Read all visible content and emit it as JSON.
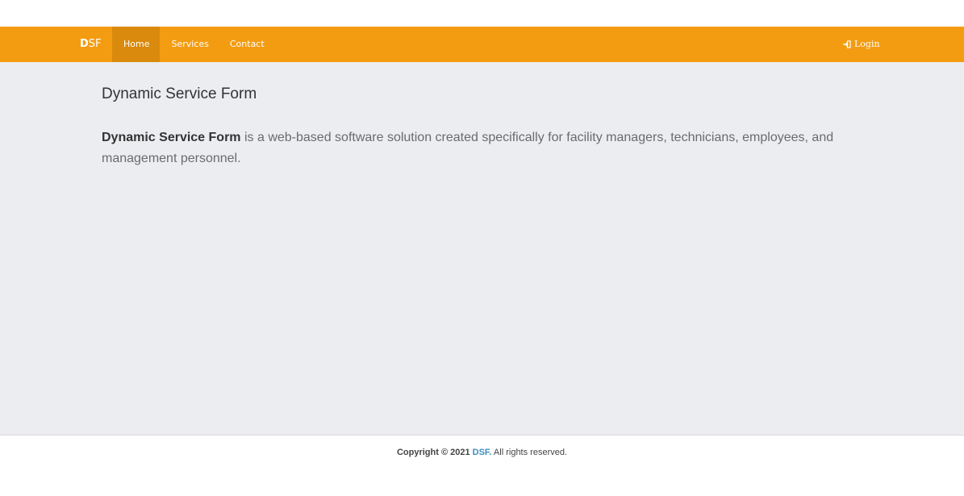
{
  "navbar": {
    "brand_bold": "D",
    "brand_rest": "SF",
    "items": [
      {
        "label": "Home",
        "active": true
      },
      {
        "label": "Services",
        "active": false
      },
      {
        "label": "Contact",
        "active": false
      }
    ],
    "login_label": "Login",
    "login_icon": "sign-in-icon",
    "background_color": "#f39c12",
    "active_color": "#da8a0c"
  },
  "main": {
    "title": "Dynamic Service Form",
    "intro_strong": "Dynamic Service Form",
    "intro_rest": " is a web-based software solution created specifically for facility managers, technicians, employees, and management personnel.",
    "background_color": "#ecedf1"
  },
  "footer": {
    "prefix": "Copyright © 2021 ",
    "brand_link": "DSF.",
    "suffix": " All rights reserved.",
    "link_color": "#3c8dbc"
  }
}
